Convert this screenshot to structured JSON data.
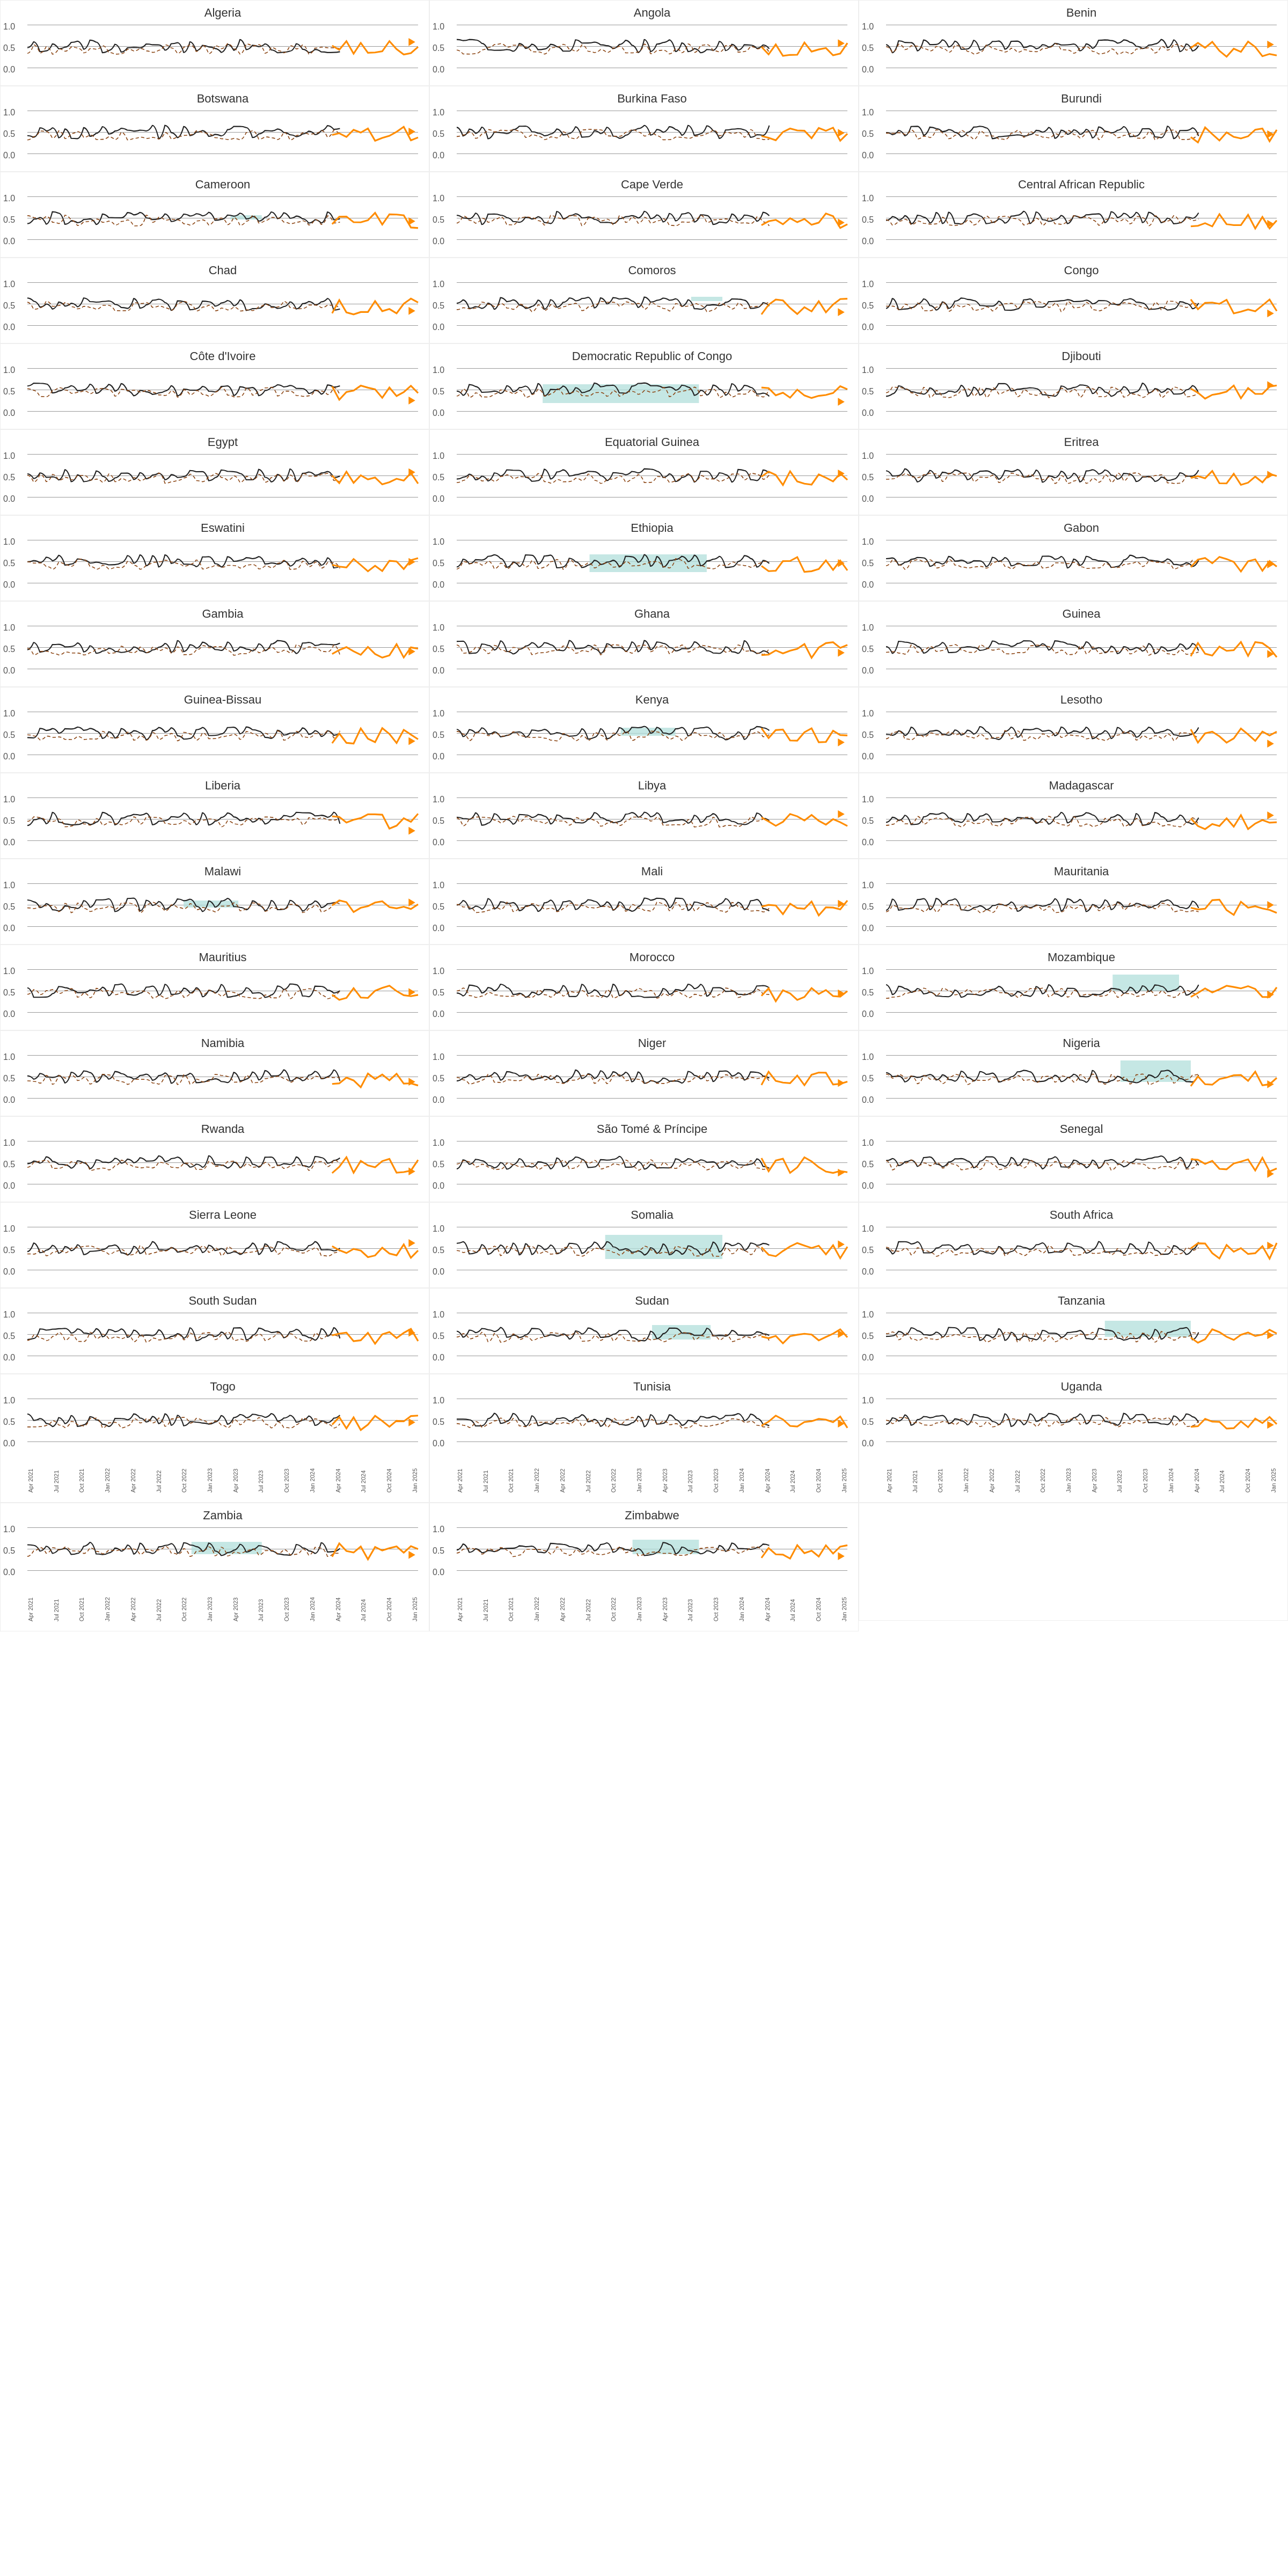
{
  "charts": [
    {
      "name": "Algeria",
      "col": 0,
      "highlight": null
    },
    {
      "name": "Angola",
      "col": 1,
      "highlight": null
    },
    {
      "name": "Benin",
      "col": 2,
      "highlight": null
    },
    {
      "name": "Botswana",
      "col": 0,
      "highlight": null
    },
    {
      "name": "Burkina Faso",
      "col": 1,
      "highlight": null
    },
    {
      "name": "Burundi",
      "col": 2,
      "highlight": null
    },
    {
      "name": "Cameroon",
      "col": 0,
      "highlight": [
        0.52,
        0.6
      ]
    },
    {
      "name": "Cape Verde",
      "col": 1,
      "highlight": null
    },
    {
      "name": "Central African Republic",
      "col": 2,
      "highlight": null
    },
    {
      "name": "Chad",
      "col": 0,
      "highlight": null
    },
    {
      "name": "Comoros",
      "col": 1,
      "highlight": [
        0.6,
        0.68
      ]
    },
    {
      "name": "Congo",
      "col": 2,
      "highlight": null
    },
    {
      "name": "Côte d'Ivoire",
      "col": 0,
      "highlight": null
    },
    {
      "name": "Democratic Republic of Congo",
      "col": 1,
      "highlight": [
        0.3,
        0.65
      ]
    },
    {
      "name": "Djibouti",
      "col": 2,
      "highlight": null
    },
    {
      "name": "Egypt",
      "col": 0,
      "highlight": null
    },
    {
      "name": "Equatorial Guinea",
      "col": 1,
      "highlight": null
    },
    {
      "name": "Eritrea",
      "col": 2,
      "highlight": null
    },
    {
      "name": "Eswatini",
      "col": 0,
      "highlight": null
    },
    {
      "name": "Ethiopia",
      "col": 1,
      "highlight": [
        0.35,
        0.68
      ]
    },
    {
      "name": "Gabon",
      "col": 2,
      "highlight": null
    },
    {
      "name": "Gambia",
      "col": 0,
      "highlight": null
    },
    {
      "name": "Ghana",
      "col": 1,
      "highlight": null
    },
    {
      "name": "Guinea",
      "col": 2,
      "highlight": null
    },
    {
      "name": "Guinea-Bissau",
      "col": 0,
      "highlight": null
    },
    {
      "name": "Kenya",
      "col": 1,
      "highlight": [
        0.5,
        0.65
      ]
    },
    {
      "name": "Lesotho",
      "col": 2,
      "highlight": null
    },
    {
      "name": "Liberia",
      "col": 0,
      "highlight": null
    },
    {
      "name": "Libya",
      "col": 1,
      "highlight": null
    },
    {
      "name": "Madagascar",
      "col": 2,
      "highlight": null
    },
    {
      "name": "Malawi",
      "col": 0,
      "highlight": [
        0.5,
        0.63
      ]
    },
    {
      "name": "Mali",
      "col": 1,
      "highlight": null
    },
    {
      "name": "Mauritania",
      "col": 2,
      "highlight": null
    },
    {
      "name": "Mauritius",
      "col": 0,
      "highlight": null
    },
    {
      "name": "Morocco",
      "col": 1,
      "highlight": null
    },
    {
      "name": "Mozambique",
      "col": 2,
      "highlight": [
        0.55,
        0.85
      ]
    },
    {
      "name": "Namibia",
      "col": 0,
      "highlight": null
    },
    {
      "name": "Niger",
      "col": 1,
      "highlight": null
    },
    {
      "name": "Nigeria",
      "col": 2,
      "highlight": [
        0.45,
        0.85
      ]
    },
    {
      "name": "Rwanda",
      "col": 0,
      "highlight": null
    },
    {
      "name": "São Tomé & Príncipe",
      "col": 1,
      "highlight": null
    },
    {
      "name": "Senegal",
      "col": 2,
      "highlight": null
    },
    {
      "name": "Sierra Leone",
      "col": 0,
      "highlight": null
    },
    {
      "name": "Somalia",
      "col": 1,
      "highlight": [
        0.35,
        0.8
      ]
    },
    {
      "name": "South Africa",
      "col": 2,
      "highlight": null
    },
    {
      "name": "South Sudan",
      "col": 0,
      "highlight": null
    },
    {
      "name": "Sudan",
      "col": 1,
      "highlight": [
        0.45,
        0.72
      ]
    },
    {
      "name": "Tanzania",
      "col": 2,
      "highlight": [
        0.5,
        0.8
      ]
    },
    {
      "name": "Togo",
      "col": 0,
      "highlight": null
    },
    {
      "name": "Tunisia",
      "col": 1,
      "highlight": null
    },
    {
      "name": "Uganda",
      "col": 2,
      "highlight": null
    },
    {
      "name": "Zambia",
      "col": 0,
      "highlight": [
        0.45,
        0.68
      ]
    },
    {
      "name": "Zimbabwe",
      "col": 1,
      "highlight": [
        0.45,
        0.72
      ]
    }
  ],
  "xLabels": [
    "Apr 2021",
    "Jul 2021",
    "Oct 2021",
    "Jan 2022",
    "Apr 2022",
    "Jul 2022",
    "Oct 2022",
    "Jan 2023",
    "Apr 2023",
    "Jul 2023",
    "Oct 2023",
    "Jan 2024",
    "Apr 2024",
    "Jul 2024",
    "Oct 2024",
    "Jan 2025"
  ]
}
